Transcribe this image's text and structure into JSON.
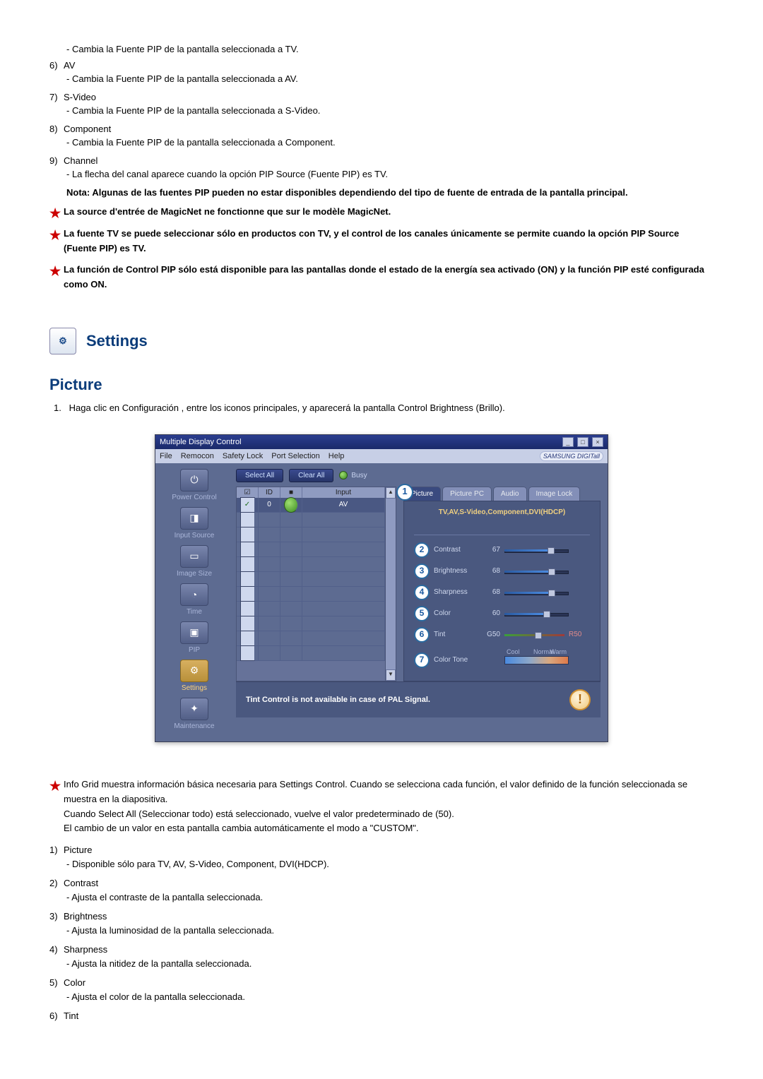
{
  "top_list": [
    {
      "num": "6)",
      "label": "AV",
      "sub": "- Cambia la Fuente PIP de la pantalla seleccionada a AV."
    },
    {
      "num": "7)",
      "label": "S-Video",
      "sub": "- Cambia la Fuente PIP de la pantalla seleccionada a S-Video."
    },
    {
      "num": "8)",
      "label": "Component",
      "sub": "- Cambia la Fuente PIP de la pantalla seleccionada a Component."
    },
    {
      "num": "9)",
      "label": "Channel",
      "sub": "- La flecha del canal aparece cuando la opción PIP Source (Fuente PIP) es TV."
    }
  ],
  "pre_sub": "- Cambia la Fuente PIP de la pantalla seleccionada a TV.",
  "note_bold": "Nota: Algunas de las fuentes PIP pueden no estar disponibles dependiendo del tipo de fuente de entrada de la pantalla principal.",
  "stars": [
    "La source d'entrée de MagicNet ne fonctionne que sur le modèle MagicNet.",
    "La fuente TV se puede seleccionar sólo en productos con TV, y el control de los canales únicamente se permite cuando la opción PIP Source (Fuente PIP) es TV.",
    "La función de Control PIP sólo está disponible para las pantallas donde el estado de la energía sea activado (ON) y la función PIP esté configurada como ON."
  ],
  "settings_title": "Settings",
  "picture_title": "Picture",
  "step1_num": "1.",
  "step1_text": "Haga clic en Configuración , entre los iconos principales, y aparecerá la pantalla Control Brightness (Brillo).",
  "screenshot": {
    "window_title": "Multiple Display Control",
    "menus": [
      "File",
      "Remocon",
      "Safety Lock",
      "Port Selection",
      "Help"
    ],
    "brand": "SAMSUNG DIGITall",
    "sidebar": [
      {
        "label": "Power Control",
        "icon": "⏻"
      },
      {
        "label": "Input Source",
        "icon": "◨"
      },
      {
        "label": "Image Size",
        "icon": "▭"
      },
      {
        "label": "Time",
        "icon": "◔"
      },
      {
        "label": "PIP",
        "icon": "▣"
      },
      {
        "label": "Settings",
        "icon": "⚙",
        "active": true
      },
      {
        "label": "Maintenance",
        "icon": "✦"
      }
    ],
    "select_all": "Select All",
    "clear_all": "Clear All",
    "busy": "Busy",
    "grid_headers": {
      "chk": "☑",
      "id": "ID",
      "st": "■",
      "input": "Input"
    },
    "first_row": {
      "id": "0",
      "input": "AV"
    },
    "tabs": [
      "Picture",
      "Picture PC",
      "Audio",
      "Image Lock"
    ],
    "panel_header": "TV,AV,S-Video,Component,DVI(HDCP)",
    "controls": [
      {
        "n": "2",
        "label": "Contrast",
        "value": "67",
        "fill": 67
      },
      {
        "n": "3",
        "label": "Brightness",
        "value": "68",
        "fill": 68
      },
      {
        "n": "4",
        "label": "Sharpness",
        "value": "68",
        "fill": 68
      },
      {
        "n": "5",
        "label": "Color",
        "value": "60",
        "fill": 60
      }
    ],
    "tint": {
      "n": "6",
      "label": "Tint",
      "g": "G50",
      "r": "R50"
    },
    "colortone": {
      "n": "7",
      "label": "Color Tone",
      "labels": [
        "Cool",
        "Normal",
        "Warm"
      ]
    },
    "footer_msg": "Tint Control is not available in case of PAL Signal."
  },
  "bottom_star": {
    "line1": "Info Grid muestra información básica necesaria para Settings Control. Cuando se selecciona cada función, el valor definido de la función seleccionada se muestra en la diapositiva.",
    "line2": "Cuando Select All (Seleccionar todo) está seleccionado, vuelve el valor predeterminado de (50).",
    "line3": "El cambio de un valor en esta pantalla cambia automáticamente el modo a \"CUSTOM\"."
  },
  "bottom_list": [
    {
      "num": "1)",
      "label": "Picture",
      "sub": "- Disponible sólo para TV, AV, S-Video, Component, DVI(HDCP)."
    },
    {
      "num": "2)",
      "label": "Contrast",
      "sub": "- Ajusta el contraste de la pantalla seleccionada."
    },
    {
      "num": "3)",
      "label": "Brightness",
      "sub": "- Ajusta la luminosidad de la pantalla seleccionada."
    },
    {
      "num": "4)",
      "label": "Sharpness",
      "sub": "- Ajusta la nitidez de la pantalla seleccionada."
    },
    {
      "num": "5)",
      "label": "Color",
      "sub": "- Ajusta el color de la pantalla seleccionada."
    },
    {
      "num": "6)",
      "label": "Tint",
      "sub": ""
    }
  ]
}
